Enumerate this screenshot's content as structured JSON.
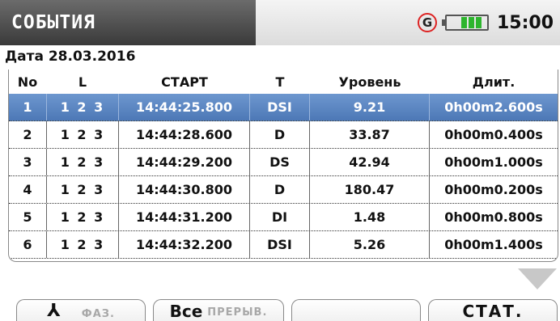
{
  "header": {
    "title": "СОБЫТИЯ",
    "g_label": "G",
    "battery_icon": "battery-full-icon",
    "time": "15:00"
  },
  "date_line": "Дата 28.03.2016",
  "table": {
    "columns": [
      "No",
      "L",
      "СТАРТ",
      "T",
      "Уровень",
      "Длит."
    ],
    "rows": [
      {
        "no": "1",
        "l": "1 2 3",
        "start": "14:44:25.800",
        "t": "DSI",
        "level": "9.21",
        "dur": "0h00m2.600s",
        "selected": true
      },
      {
        "no": "2",
        "l": "1 2 3",
        "start": "14:44:28.600",
        "t": "D",
        "level": "33.87",
        "dur": "0h00m0.400s"
      },
      {
        "no": "3",
        "l": "1 2 3",
        "start": "14:44:29.200",
        "t": "DS",
        "level": "42.94",
        "dur": "0h00m1.000s"
      },
      {
        "no": "4",
        "l": "1 2 3",
        "start": "14:44:30.800",
        "t": "D",
        "level": "180.47",
        "dur": "0h00m0.200s"
      },
      {
        "no": "5",
        "l": "1 2 3",
        "start": "14:44:31.200",
        "t": "DI",
        "level": "1.48",
        "dur": "0h00m0.800s"
      },
      {
        "no": "6",
        "l": "1 2 3",
        "start": "14:44:32.200",
        "t": "DSI",
        "level": "5.26",
        "dur": "0h00m1.400s"
      }
    ]
  },
  "softkeys": {
    "phase_icon": "⅄",
    "phase_label": "ФАЗ.",
    "all_main": "Все",
    "all_sub": "ПРЕРЫВ.",
    "stat_label": "СТАТ."
  },
  "colors": {
    "selected_row": "#5a84c2",
    "g_ring": "#dd2222",
    "battery": "#2db52d"
  }
}
